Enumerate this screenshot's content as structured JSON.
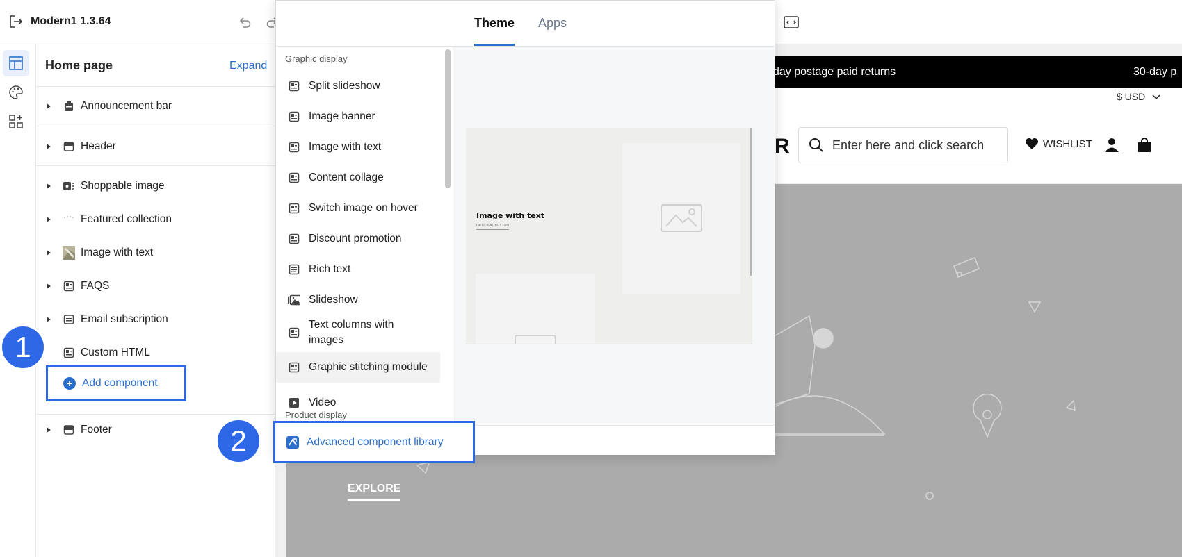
{
  "app": {
    "title": "Modern1 1.3.64"
  },
  "sidebar": {
    "title": "Home page",
    "expand_label": "Expand",
    "items": [
      {
        "label": "Announcement bar"
      },
      {
        "label": "Header"
      },
      {
        "label": "Shoppable image"
      },
      {
        "label": "Featured collection"
      },
      {
        "label": "Image with text"
      },
      {
        "label": "FAQS"
      },
      {
        "label": "Email subscription"
      },
      {
        "label": "Custom HTML"
      }
    ],
    "add_component_label": "Add component",
    "footer_label": "Footer"
  },
  "steps": {
    "one": "1",
    "two": "2"
  },
  "popup": {
    "tabs": {
      "theme": "Theme",
      "apps": "Apps"
    },
    "categories": {
      "graphic": "Graphic display",
      "product": "Product display"
    },
    "components": [
      {
        "label": "Split slideshow"
      },
      {
        "label": "Image banner"
      },
      {
        "label": "Image with text"
      },
      {
        "label": "Content collage"
      },
      {
        "label": "Switch image on hover"
      },
      {
        "label": "Discount promotion"
      },
      {
        "label": "Rich text"
      },
      {
        "label": "Slideshow"
      },
      {
        "label": "Text columns with images"
      },
      {
        "label": "Graphic stitching module"
      },
      {
        "label": "Video"
      }
    ],
    "preview": {
      "title": "Image with text",
      "button": "OPTIONAL BUTTON"
    },
    "advanced_library_label": "Advanced component library"
  },
  "storefront": {
    "announcement_1": "day postage paid returns",
    "announcement_2": "30-day p",
    "currency": "$ USD",
    "logo_fragment": "R",
    "search_placeholder": "Enter here and click search",
    "wishlist_label": "WISHLIST",
    "explore_label": "EXPLORE"
  },
  "colors": {
    "accent": "#2c6ecb",
    "highlight_border": "#2f68e6",
    "hero_bg": "#ababab"
  }
}
